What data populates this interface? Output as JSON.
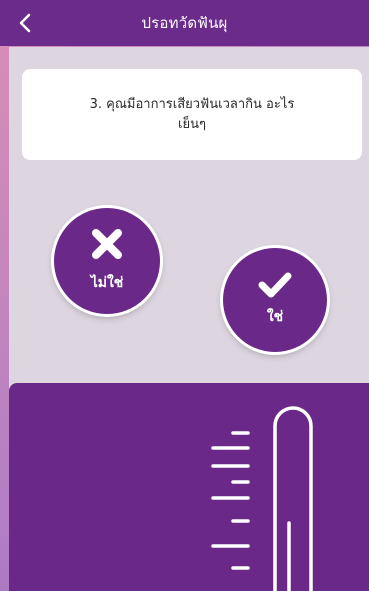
{
  "header": {
    "title": "ปรอทวัดฟันผุ",
    "back_icon": "chevron-left-icon"
  },
  "question": {
    "text": "3. คุณมีอาการเสียวฟันเวลากิน อะไรเย็นๆ"
  },
  "answers": {
    "no": {
      "label": "ไม่ใช่",
      "icon": "x-icon"
    },
    "yes": {
      "label": "ใช่",
      "icon": "check-icon"
    }
  },
  "illustration": {
    "icon": "thermometer-icon"
  },
  "colors": {
    "primary": "#6a2888",
    "header": "#6b2b8a",
    "panel": "#ddd5df"
  }
}
